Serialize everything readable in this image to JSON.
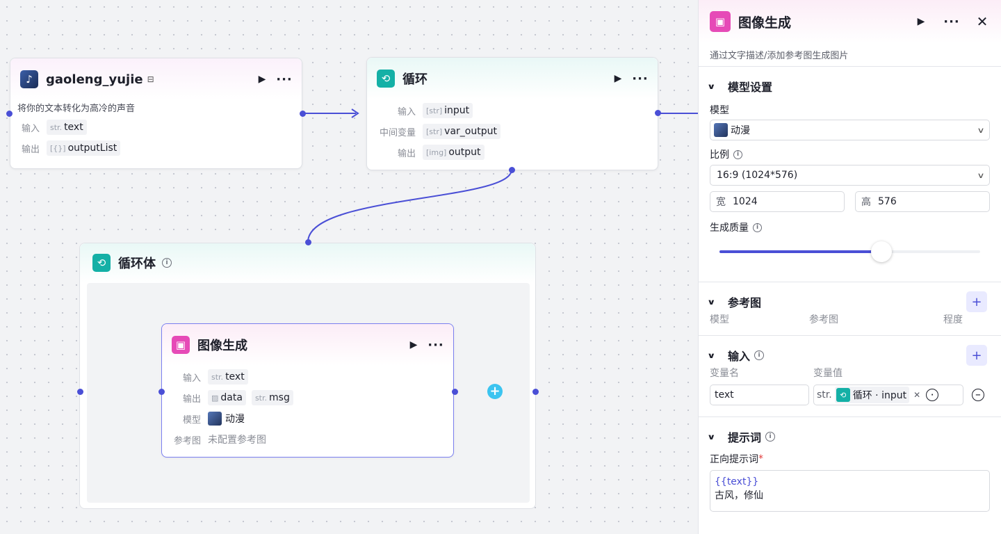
{
  "nodes": {
    "tts": {
      "title": "gaoleng_yujie",
      "description": "将你的文本转化为高冷的声音",
      "input_label": "输入",
      "input_type": "str.",
      "input_name": "text",
      "output_label": "输出",
      "output_type": "[{}]",
      "output_name": "outputList"
    },
    "loop": {
      "title": "循环",
      "input_label": "输入",
      "input_type": "[str]",
      "input_name": "input",
      "mid_label": "中间变量",
      "mid_type": "[str]",
      "mid_name": "var_output",
      "output_label": "输出",
      "output_type": "[img]",
      "output_name": "output"
    },
    "loopbody": {
      "title": "循环体"
    },
    "imagegen": {
      "title": "图像生成",
      "input_label": "输入",
      "input_type": "str.",
      "input_name": "text",
      "output_label": "输出",
      "output1_name": "data",
      "output2_type": "str.",
      "output2_name": "msg",
      "model_label": "模型",
      "model_value": "动漫",
      "ref_label": "参考图",
      "ref_value": "未配置参考图"
    }
  },
  "panel": {
    "title": "图像生成",
    "description": "通过文字描述/添加参考图生成图片",
    "model_section": {
      "title": "模型设置",
      "model_label": "模型",
      "model_value": "动漫",
      "ratio_label": "比例",
      "ratio_value": "16:9 (1024*576)",
      "width_key": "宽",
      "width_value": "1024",
      "height_key": "高",
      "height_value": "576",
      "quality_label": "生成质量",
      "quality_fraction": 0.62
    },
    "ref_section": {
      "title": "参考图",
      "col_model": "模型",
      "col_ref": "参考图",
      "col_degree": "程度"
    },
    "input_section": {
      "title": "输入",
      "col_name": "变量名",
      "col_value": "变量值",
      "var_name": "text",
      "var_type": "str.",
      "ref_text": "循环 · input"
    },
    "prompt_section": {
      "title": "提示词",
      "positive_label": "正向提示词",
      "required_mark": "*",
      "line1": "{{text}}",
      "line2": "古风，修仙"
    }
  },
  "colors": {
    "accent": "#4a4fd6",
    "teal": "#14b0a6",
    "pink": "#e64ab7",
    "cyan": "#3cc4f0"
  },
  "icons": [
    "play-icon",
    "more-icon",
    "close-icon",
    "loop-icon",
    "image-gen-icon",
    "info-icon",
    "chevron-down-icon",
    "plus-icon"
  ]
}
